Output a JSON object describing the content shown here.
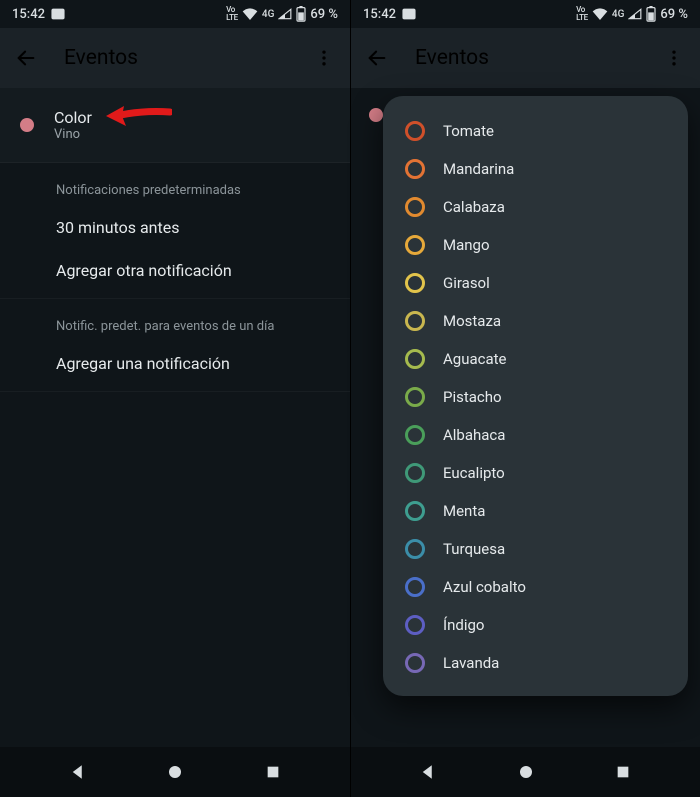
{
  "status": {
    "time": "15:42",
    "lte": "Vo LTE",
    "signal_text": "4G",
    "battery_text": "69 %"
  },
  "left": {
    "title": "Eventos",
    "color_label": "Color",
    "color_value": "Vino",
    "section1_label": "Notificaciones predeterminadas",
    "notif_time": "30 minutos antes",
    "add_notif": "Agregar otra notificación",
    "section2_label": "Notific. predet. para eventos de un día",
    "add_notif2": "Agregar una notificación"
  },
  "right": {
    "title": "Eventos"
  },
  "colors": [
    {
      "name": "Tomate",
      "hex": "#d0502a"
    },
    {
      "name": "Mandarina",
      "hex": "#e37334"
    },
    {
      "name": "Calabaza",
      "hex": "#e18a2f"
    },
    {
      "name": "Mango",
      "hex": "#e6a93a"
    },
    {
      "name": "Girasol",
      "hex": "#e2c44b"
    },
    {
      "name": "Mostaza",
      "hex": "#c9b74f"
    },
    {
      "name": "Aguacate",
      "hex": "#a6bb4e"
    },
    {
      "name": "Pistacho",
      "hex": "#7aab4a"
    },
    {
      "name": "Albahaca",
      "hex": "#4a9f5a"
    },
    {
      "name": "Eucalipto",
      "hex": "#3f9978"
    },
    {
      "name": "Menta",
      "hex": "#3e9e90"
    },
    {
      "name": "Turquesa",
      "hex": "#3b8ea9"
    },
    {
      "name": "Azul cobalto",
      "hex": "#4a6fc9"
    },
    {
      "name": "Índigo",
      "hex": "#5d5ec3"
    },
    {
      "name": "Lavanda",
      "hex": "#7768b5"
    }
  ]
}
